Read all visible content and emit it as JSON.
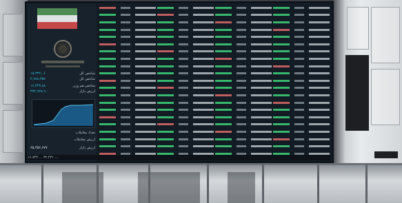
{
  "left_panel": {
    "index_rows": [
      {
        "value": "۱۵,۳۳۲,۰۶",
        "label": "شاخص کل"
      },
      {
        "value": "۲,۹۷۸,۳۵۷",
        "label": "شاخص کل"
      },
      {
        "value": "۱۶,۳۴۳,۸۸",
        "label": "شاخص هم وزن"
      },
      {
        "value": "۳۷۴,۹۳۸,۹۰",
        "label": "ارزش بازار"
      }
    ],
    "bottom_rows": [
      {
        "label": "تعداد معاملات",
        "value": ""
      },
      {
        "label": "ارزش معاملات",
        "value": ""
      },
      {
        "label": "ارزش بازار",
        "value": "۶۵,۴۵۶,۶۷۷"
      }
    ]
  },
  "ticker_text": "۱۶,۷۴۳   ...   ۳۲,۴۳۱   ...",
  "accent_colors": {
    "positive": "#3fd37a",
    "negative": "#e06a6a",
    "index": "#2fc5e6"
  }
}
